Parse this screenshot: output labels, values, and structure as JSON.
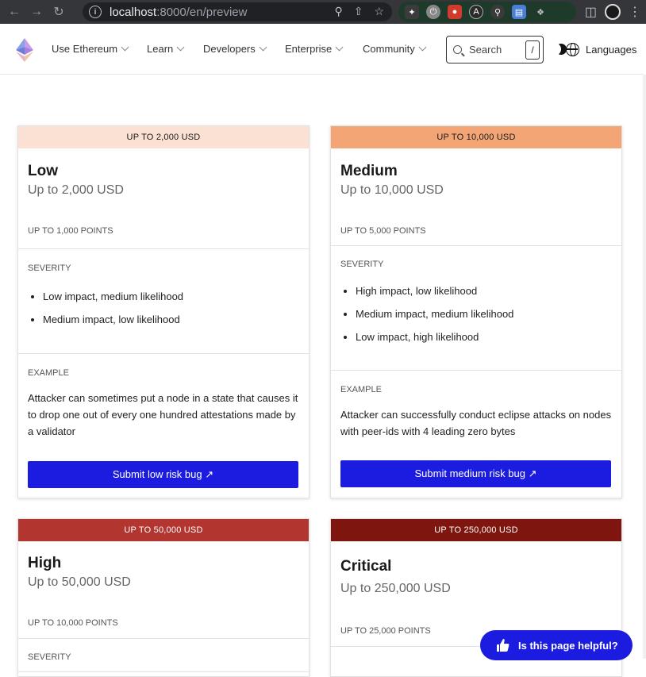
{
  "browser": {
    "url_host": "localhost",
    "url_rest": ":8000/en/preview"
  },
  "header": {
    "nav": [
      "Use Ethereum",
      "Learn",
      "Developers",
      "Enterprise",
      "Community"
    ],
    "search_label": "Search",
    "search_shortcut": "/",
    "languages_label": "Languages"
  },
  "cards": [
    {
      "band": "UP TO 2,000 USD",
      "band_color": "#fbe1d3",
      "band_text_color": "#1a1a1a",
      "title": "Low",
      "subtitle": "Up to 2,000 USD",
      "points": "UP TO 1,000 POINTS",
      "severity_label": "SEVERITY",
      "severity": [
        "Low impact, medium likelihood",
        "Medium impact, low likelihood"
      ],
      "example_label": "EXAMPLE",
      "example": "Attacker can sometimes put a node in a state that causes it to drop one out of every one hundred attestations made by a validator",
      "button": "Submit low risk bug ↗"
    },
    {
      "band": "UP TO 10,000 USD",
      "band_color": "#f4a575",
      "band_text_color": "#1a1a1a",
      "title": "Medium",
      "subtitle": "Up to 10,000 USD",
      "points": "UP TO 5,000 POINTS",
      "severity_label": "SEVERITY",
      "severity": [
        "High impact, low likelihood",
        "Medium impact, medium likelihood",
        "Low impact, high likelihood"
      ],
      "example_label": "EXAMPLE",
      "example": "Attacker can successfully conduct eclipse attacks on nodes with peer-ids with 4 leading zero bytes",
      "button": "Submit medium risk bug ↗"
    },
    {
      "band": "UP TO 50,000 USD",
      "band_color": "#b23530",
      "band_text_color": "#ffffff",
      "title": "High",
      "subtitle": "Up to 50,000 USD",
      "points": "UP TO 10,000 POINTS",
      "severity_label": "SEVERITY"
    },
    {
      "band": "UP TO 250,000 USD",
      "band_color": "#7e160f",
      "band_text_color": "#ffffff",
      "title": "Critical",
      "subtitle": "Up to 250,000 USD",
      "points": "UP TO 25,000 POINTS"
    }
  ],
  "helpful_label": "Is this page helpful?"
}
